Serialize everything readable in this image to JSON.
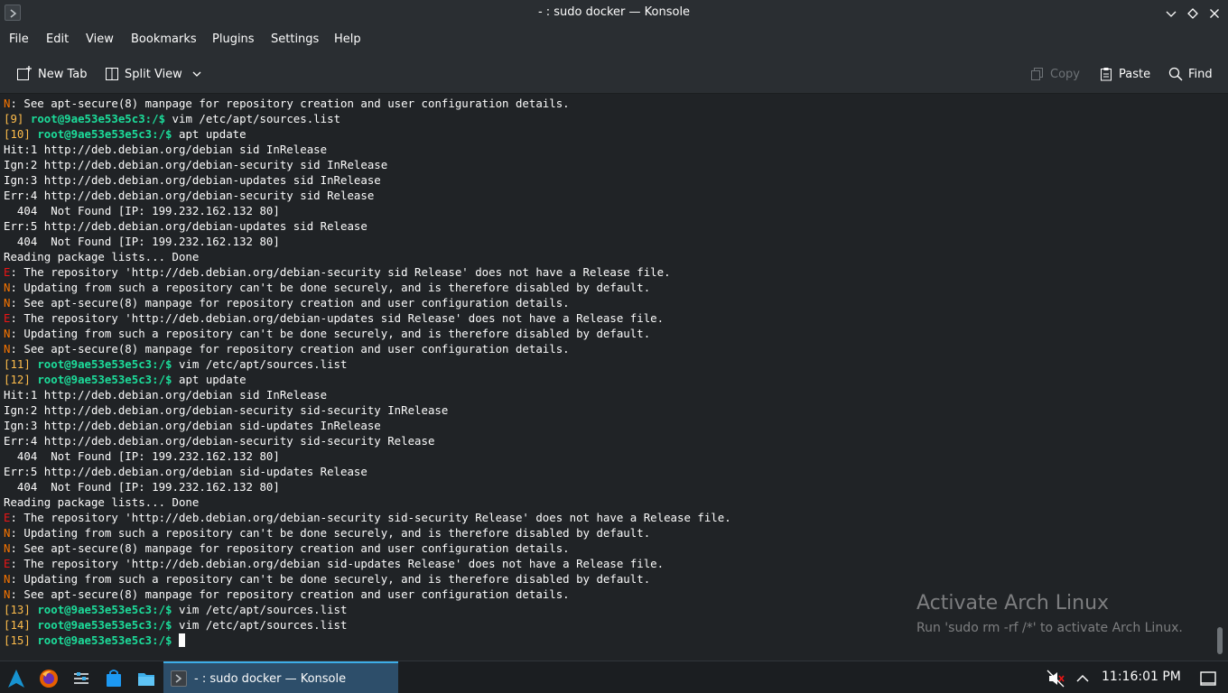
{
  "window": {
    "title": "- : sudo docker — Konsole"
  },
  "menu": [
    "File",
    "Edit",
    "View",
    "Bookmarks",
    "Plugins",
    "Settings",
    "Help"
  ],
  "toolbar": {
    "new_tab": "New Tab",
    "split_view": "Split View",
    "copy": "Copy",
    "paste": "Paste",
    "find": "Find"
  },
  "terminal": {
    "lines": [
      {
        "tag": "N",
        "text": "See apt-secure(8) manpage for repository creation and user configuration details."
      },
      {
        "num": "[9]",
        "prompt": "root@9ae53e53e5c3:/$",
        "cmd": "vim /etc/apt/sources.list"
      },
      {
        "num": "[10]",
        "prompt": "root@9ae53e53e5c3:/$",
        "cmd": "apt update"
      },
      {
        "text": "Hit:1 http://deb.debian.org/debian sid InRelease"
      },
      {
        "text": "Ign:2 http://deb.debian.org/debian-security sid InRelease"
      },
      {
        "text": "Ign:3 http://deb.debian.org/debian-updates sid InRelease"
      },
      {
        "text": "Err:4 http://deb.debian.org/debian-security sid Release"
      },
      {
        "text": "  404  Not Found [IP: 199.232.162.132 80]"
      },
      {
        "text": "Err:5 http://deb.debian.org/debian-updates sid Release"
      },
      {
        "text": "  404  Not Found [IP: 199.232.162.132 80]"
      },
      {
        "text": "Reading package lists... Done"
      },
      {
        "tag": "E",
        "text": "The repository 'http://deb.debian.org/debian-security sid Release' does not have a Release file."
      },
      {
        "tag": "N",
        "text": "Updating from such a repository can't be done securely, and is therefore disabled by default."
      },
      {
        "tag": "N",
        "text": "See apt-secure(8) manpage for repository creation and user configuration details."
      },
      {
        "tag": "E",
        "text": "The repository 'http://deb.debian.org/debian-updates sid Release' does not have a Release file."
      },
      {
        "tag": "N",
        "text": "Updating from such a repository can't be done securely, and is therefore disabled by default."
      },
      {
        "tag": "N",
        "text": "See apt-secure(8) manpage for repository creation and user configuration details."
      },
      {
        "num": "[11]",
        "prompt": "root@9ae53e53e5c3:/$",
        "cmd": "vim /etc/apt/sources.list"
      },
      {
        "num": "[12]",
        "prompt": "root@9ae53e53e5c3:/$",
        "cmd": "apt update"
      },
      {
        "text": "Hit:1 http://deb.debian.org/debian sid InRelease"
      },
      {
        "text": "Ign:2 http://deb.debian.org/debian-security sid-security InRelease"
      },
      {
        "text": "Ign:3 http://deb.debian.org/debian sid-updates InRelease"
      },
      {
        "text": "Err:4 http://deb.debian.org/debian-security sid-security Release"
      },
      {
        "text": "  404  Not Found [IP: 199.232.162.132 80]"
      },
      {
        "text": "Err:5 http://deb.debian.org/debian sid-updates Release"
      },
      {
        "text": "  404  Not Found [IP: 199.232.162.132 80]"
      },
      {
        "text": "Reading package lists... Done"
      },
      {
        "tag": "E",
        "text": "The repository 'http://deb.debian.org/debian-security sid-security Release' does not have a Release file."
      },
      {
        "tag": "N",
        "text": "Updating from such a repository can't be done securely, and is therefore disabled by default."
      },
      {
        "tag": "N",
        "text": "See apt-secure(8) manpage for repository creation and user configuration details."
      },
      {
        "tag": "E",
        "text": "The repository 'http://deb.debian.org/debian sid-updates Release' does not have a Release file."
      },
      {
        "tag": "N",
        "text": "Updating from such a repository can't be done securely, and is therefore disabled by default."
      },
      {
        "tag": "N",
        "text": "See apt-secure(8) manpage for repository creation and user configuration details."
      },
      {
        "num": "[13]",
        "prompt": "root@9ae53e53e5c3:/$",
        "cmd": "vim /etc/apt/sources.list"
      },
      {
        "num": "[14]",
        "prompt": "root@9ae53e53e5c3:/$",
        "cmd": "vim /etc/apt/sources.list"
      },
      {
        "num": "[15]",
        "prompt": "root@9ae53e53e5c3:/$",
        "cmd": "",
        "cursor": true
      }
    ]
  },
  "watermark": {
    "title": "Activate Arch Linux",
    "subtitle": "Run 'sudo rm -rf /*' to activate Arch Linux."
  },
  "taskbar": {
    "task_label": "- : sudo docker — Konsole",
    "clock": "11:16:01 PM",
    "launchers": [
      "app-launcher-icon",
      "firefox-icon",
      "system-settings-icon",
      "discover-icon",
      "file-manager-icon"
    ]
  },
  "colors": {
    "error_tag": "#ed1515",
    "notice_tag": "#f67400",
    "history_number": "#fdbc4b",
    "prompt": "#1cdc9a",
    "background": "#202326",
    "active_task": "#3daee9"
  }
}
